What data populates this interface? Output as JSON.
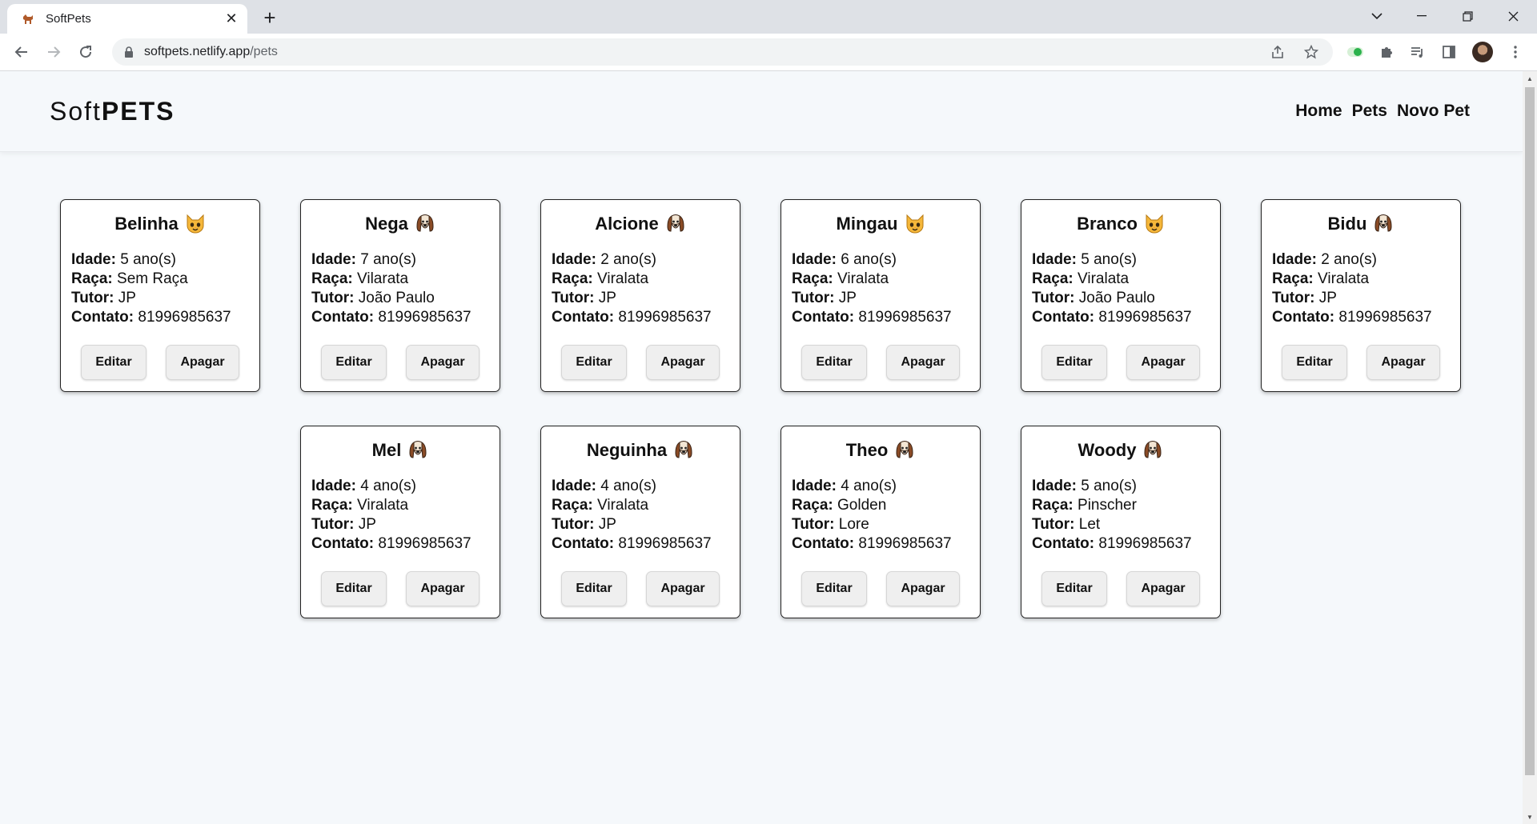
{
  "browser": {
    "tab_title": "SoftPets",
    "new_tab_symbol": "+",
    "url_host": "softpets.netlify.app",
    "url_path": "/pets"
  },
  "site": {
    "logo_light": "Soft",
    "logo_bold": "PETS",
    "nav": [
      "Home",
      "Pets",
      "Novo Pet"
    ]
  },
  "labels": {
    "idade": "Idade:",
    "raca": "Raça:",
    "tutor": "Tutor:",
    "contato": "Contato:",
    "edit": "Editar",
    "delete": "Apagar"
  },
  "pets": [
    {
      "name": "Belinha",
      "icon": "cat-icon",
      "idade": "5 ano(s)",
      "raca": "Sem Raça",
      "tutor": "JP",
      "contato": "81996985637"
    },
    {
      "name": "Nega",
      "icon": "dog-icon",
      "idade": "7 ano(s)",
      "raca": "Vilarata",
      "tutor": "João Paulo",
      "contato": "81996985637"
    },
    {
      "name": "Alcione",
      "icon": "dog-icon",
      "idade": "2 ano(s)",
      "raca": "Viralata",
      "tutor": "JP",
      "contato": "81996985637"
    },
    {
      "name": "Mingau",
      "icon": "cat-icon",
      "idade": "6 ano(s)",
      "raca": "Viralata",
      "tutor": "JP",
      "contato": "81996985637"
    },
    {
      "name": "Branco",
      "icon": "cat-icon",
      "idade": "5 ano(s)",
      "raca": "Viralata",
      "tutor": "João Paulo",
      "contato": "81996985637"
    },
    {
      "name": "Bidu",
      "icon": "dog-icon",
      "idade": "2 ano(s)",
      "raca": "Viralata",
      "tutor": "JP",
      "contato": "81996985637"
    },
    {
      "name": "Mel",
      "icon": "dog-icon",
      "idade": "4 ano(s)",
      "raca": "Viralata",
      "tutor": "JP",
      "contato": "81996985637"
    },
    {
      "name": "Neguinha",
      "icon": "dog-icon",
      "idade": "4 ano(s)",
      "raca": "Viralata",
      "tutor": "JP",
      "contato": "81996985637"
    },
    {
      "name": "Theo",
      "icon": "dog-icon",
      "idade": "4 ano(s)",
      "raca": "Golden",
      "tutor": "Lore",
      "contato": "81996985637"
    },
    {
      "name": "Woody",
      "icon": "dog-icon",
      "idade": "5 ano(s)",
      "raca": "Pinscher",
      "tutor": "Let",
      "contato": "81996985637"
    }
  ]
}
